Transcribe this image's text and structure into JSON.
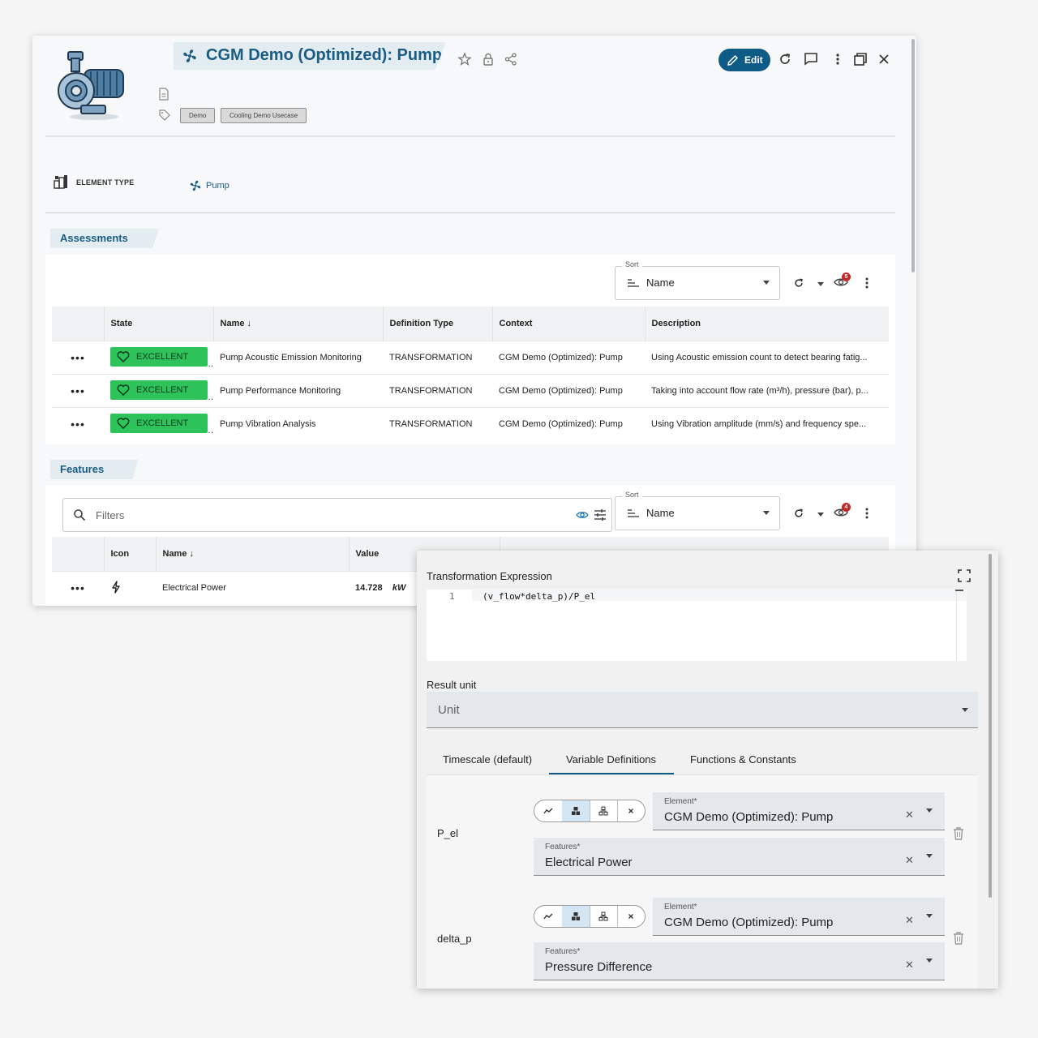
{
  "header": {
    "title": "CGM Demo (Optimized): Pump",
    "edit_label": "Edit",
    "tags": [
      "Demo",
      "Cooling Demo Usecase"
    ]
  },
  "element_type": {
    "label": "ELEMENT TYPE",
    "value": "Pump"
  },
  "assessments": {
    "section_label": "Assessments",
    "sort": {
      "legend": "Sort",
      "value": "Name"
    },
    "badge_count": "5",
    "columns": [
      "State",
      "Name",
      "Definition Type",
      "Context",
      "Description"
    ],
    "rows": [
      {
        "state": "EXCELLENT",
        "name": "Pump Acoustic Emission Monitoring",
        "definition_type": "TRANSFORMATION",
        "context": "CGM Demo (Optimized): Pump",
        "description": "Using Acoustic emission count to detect bearing fatig..."
      },
      {
        "state": "EXCELLENT",
        "name": "Pump Performance Monitoring",
        "definition_type": "TRANSFORMATION",
        "context": "CGM Demo (Optimized): Pump",
        "description": "Taking into account flow rate (m³/h), pressure (bar), p..."
      },
      {
        "state": "EXCELLENT",
        "name": "Pump Vibration Analysis",
        "definition_type": "TRANSFORMATION",
        "context": "CGM Demo (Optimized): Pump",
        "description": "Using Vibration amplitude (mm/s) and frequency spe..."
      }
    ]
  },
  "features": {
    "section_label": "Features",
    "filters_placeholder": "Filters",
    "sort": {
      "legend": "Sort",
      "value": "Name"
    },
    "badge_count": "4",
    "columns": [
      "Icon",
      "Name",
      "Value"
    ],
    "rows": [
      {
        "icon": "lightning-icon",
        "name": "Electrical Power",
        "value": "14.728",
        "unit": "kW"
      }
    ]
  },
  "popup": {
    "title": "Transformation Expression",
    "code_line_number": "1",
    "code": "(v_flow*delta_p)/P_el",
    "result_unit_label": "Result unit",
    "unit_placeholder": "Unit",
    "tabs": [
      "Timescale (default)",
      "Variable Definitions",
      "Functions & Constants"
    ],
    "active_tab": "Variable Definitions",
    "variables": [
      {
        "name": "P_el",
        "element_label": "Element*",
        "element_value": "CGM Demo (Optimized): Pump",
        "feature_label": "Features*",
        "feature_value": "Electrical Power"
      },
      {
        "name": "delta_p",
        "element_label": "Element*",
        "element_value": "CGM Demo (Optimized): Pump",
        "feature_label": "Features*",
        "feature_value": "Pressure Difference"
      }
    ]
  },
  "colors": {
    "brand": "#0e5b86",
    "title_text": "#1a5c84",
    "state_excellent": "#2ec25a",
    "badge": "#c62828"
  }
}
